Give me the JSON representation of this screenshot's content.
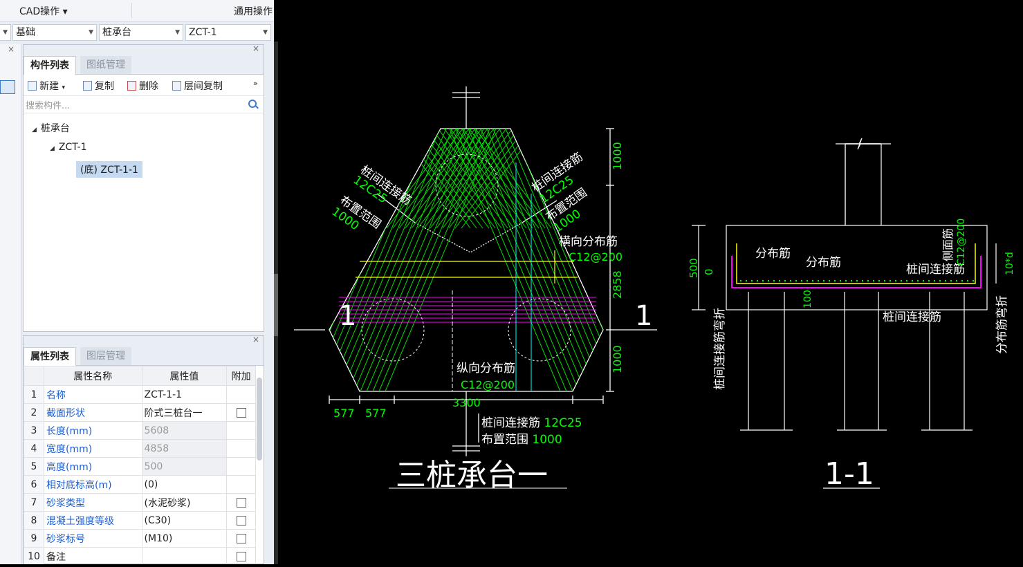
{
  "topbar": {
    "cad_menu": "CAD操作 ▾",
    "generic_ops": "通用操作"
  },
  "selectors": {
    "category": "基础",
    "type": "桩承台",
    "component": "ZCT-1"
  },
  "component_panel": {
    "tabs": [
      {
        "label": "构件列表"
      },
      {
        "label": "图纸管理"
      }
    ],
    "toolbar": {
      "new": "新建",
      "copy": "复制",
      "delete": "删除",
      "floor_copy": "层间复制"
    },
    "search_placeholder": "搜索构件...",
    "tree": {
      "root": "桩承台",
      "child": "ZCT-1",
      "leaf": "(底) ZCT-1-1"
    }
  },
  "property_panel": {
    "tabs": [
      {
        "label": "属性列表"
      },
      {
        "label": "图层管理"
      }
    ],
    "columns": [
      "属性名称",
      "属性值",
      "附加"
    ],
    "rows": [
      {
        "n": "1",
        "name": "名称",
        "value": "ZCT-1-1"
      },
      {
        "n": "2",
        "name": "截面形状",
        "value": "阶式三桩台一"
      },
      {
        "n": "3",
        "name": "长度(mm)",
        "value": "5608"
      },
      {
        "n": "4",
        "name": "宽度(mm)",
        "value": "4858"
      },
      {
        "n": "5",
        "name": "高度(mm)",
        "value": "500"
      },
      {
        "n": "6",
        "name": "相对底标高(m)",
        "value": "(0)"
      },
      {
        "n": "7",
        "name": "砂浆类型",
        "value": "(水泥砂浆)"
      },
      {
        "n": "8",
        "name": "混凝土强度等级",
        "value": "(C30)"
      },
      {
        "n": "9",
        "name": "砂浆标号",
        "value": "(M10)"
      },
      {
        "n": "10",
        "name": "备注",
        "value": ""
      }
    ]
  },
  "drawing": {
    "plan_title": "三桩承台一",
    "section_title": "1-1",
    "section_mark": "1",
    "lbl_link_rebar": "桩间连接筋",
    "lbl_12c25": "12C25",
    "lbl_range": "布置范围",
    "lbl_1000": "1000",
    "lbl_trans_dist": "横向分布筋",
    "lbl_c12_200": "C12@200",
    "lbl_long_dist": "纵向分布筋",
    "lbl_c12_200_b": "C12@200",
    "lbl_bottom_link": "桩间连接筋 12C25",
    "lbl_bottom_range": "布置范围 1000",
    "dim_1000_top": "1000",
    "dim_2858": "2858",
    "dim_1000_bot": "1000",
    "dim_3300": "3300",
    "dim_577a": "577",
    "dim_577b": "577",
    "sec_dist_a": "分布筋",
    "sec_dist_b": "分布筋",
    "sec_link": "桩间连接筋",
    "sec_link_b": "桩间连接筋",
    "sec_side": "侧面筋",
    "sec_side_spec": "C12@200",
    "sec_500": "500",
    "sec_0": "0",
    "sec_100": "100",
    "sec_10d": "10*d",
    "sec_link_bend": "桩间连接筋弯折",
    "sec_dist_bend": "分布筋弯折"
  }
}
